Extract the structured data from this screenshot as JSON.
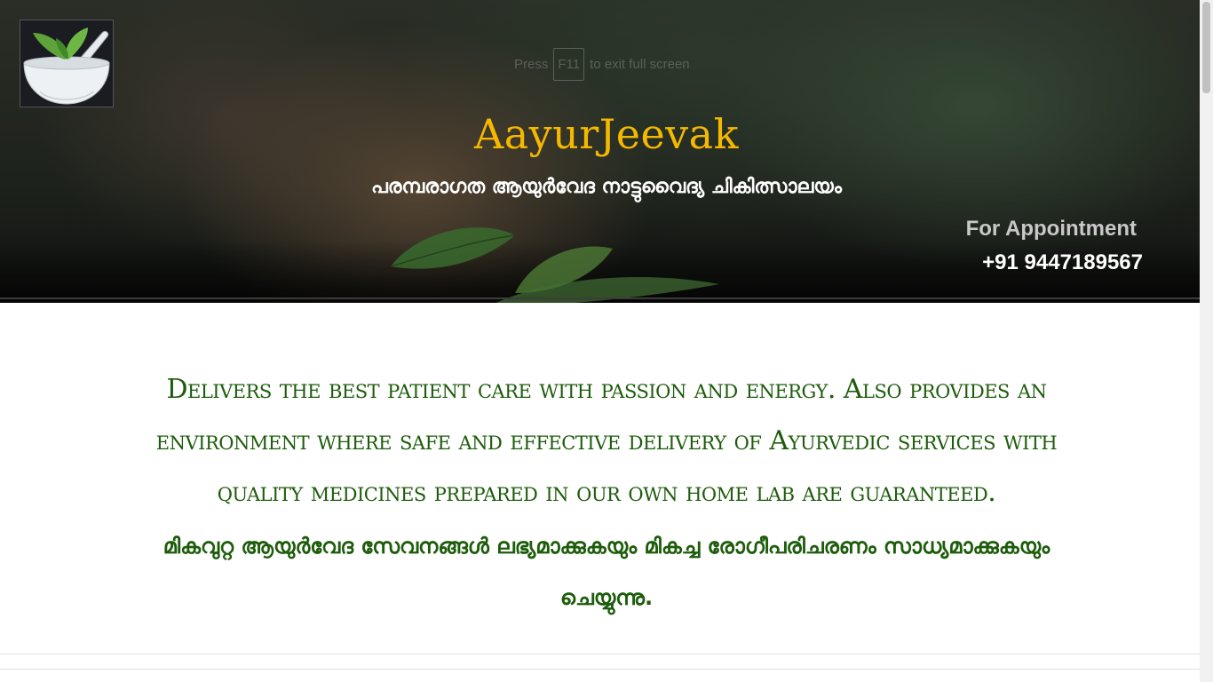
{
  "browser": {
    "fullscreen_hint": {
      "before": "Press",
      "key": "F11",
      "after": "to exit full screen"
    }
  },
  "header": {
    "brand": "AayurJeevak",
    "tagline_ml": "പരമ്പരാഗത ആയുർവേദ നാട്ടുവൈദ്യ ചികിത്സാലയം",
    "appointment": {
      "label": "For Appointment",
      "phone": "+91 9447189567"
    },
    "colors": {
      "brand": "#f5b800",
      "tagline": "#ffffff"
    }
  },
  "main": {
    "mission_en": "Delivers the best patient care with passion and energy. Also provides an environment where safe and effective delivery of Ayurvedic services with quality medicines prepared in our own home lab are guaranteed.",
    "mission_ml": "മികവുറ്റ ആയുർവേദ സേവനങ്ങൾ ലഭ്യമാക്കുകയും മികച്ച രോഗീപരിചരണം സാധ്യമാക്കുകയും ചെയ്യുന്നു.",
    "colors": {
      "text": "#1d5c0b"
    }
  },
  "icons": {
    "logo": "mortar-pestle-leaves-icon"
  }
}
